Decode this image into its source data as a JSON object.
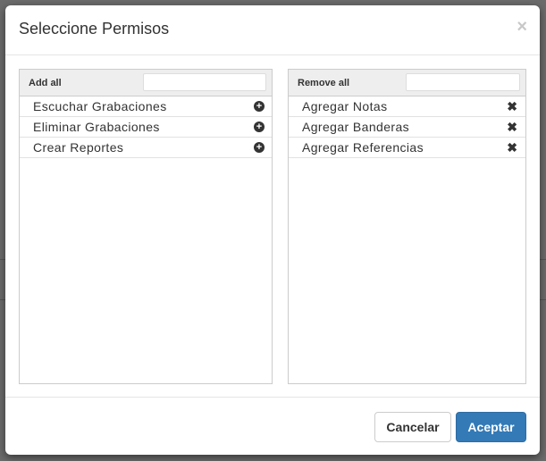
{
  "modal": {
    "title": "Seleccione Permisos",
    "close_glyph": "×"
  },
  "available": {
    "action_label": "Add all",
    "filter_value": "",
    "items": [
      {
        "label": "Escuchar Grabaciones",
        "icon": "plus-circle-icon"
      },
      {
        "label": "Eliminar Grabaciones",
        "icon": "plus-circle-icon"
      },
      {
        "label": "Crear Reportes",
        "icon": "plus-circle-icon"
      }
    ]
  },
  "selected": {
    "action_label": "Remove all",
    "filter_value": "",
    "items": [
      {
        "label": "Agregar Notas",
        "icon": "remove-icon"
      },
      {
        "label": "Agregar Banderas",
        "icon": "remove-icon"
      },
      {
        "label": "Agregar Referencias",
        "icon": "remove-icon"
      }
    ]
  },
  "footer": {
    "cancel_label": "Cancelar",
    "accept_label": "Aceptar"
  },
  "colors": {
    "primary": "#337ab7",
    "backdrop": "#6b6b6b"
  }
}
